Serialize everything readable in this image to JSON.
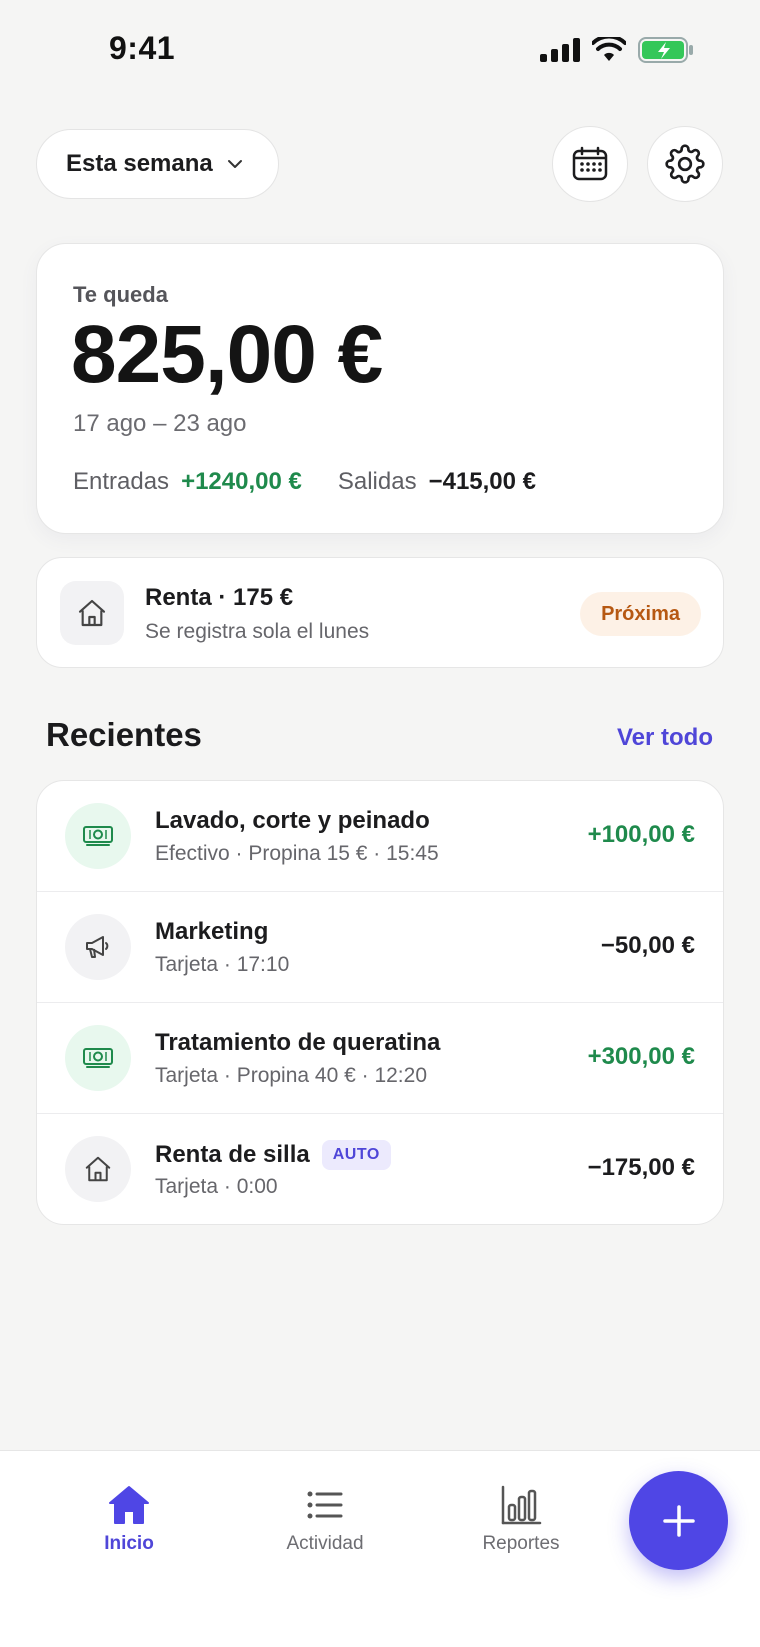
{
  "status_bar": {
    "time": "9:41"
  },
  "header": {
    "period_label": "Esta semana"
  },
  "balance": {
    "label": "Te queda",
    "amount": "825,00 €",
    "range": "17 ago – 23 ago",
    "income_label": "Entradas",
    "income_value": "+1240,00 €",
    "expense_label": "Salidas",
    "expense_value": "−415,00 €"
  },
  "recurring": {
    "title": "Renta · 175 €",
    "subtitle": "Se registra sola el lunes",
    "badge": "Próxima"
  },
  "recent": {
    "title": "Recientes",
    "see_all": "Ver todo",
    "items": [
      {
        "title": "Lavado, corte y peinado",
        "subtitle": "Efectivo · Propina 15 € · 15:45",
        "amount": "+100,00 €",
        "icon": "cash-icon"
      },
      {
        "title": "Marketing",
        "subtitle": "Tarjeta · 17:10",
        "amount": "−50,00 €",
        "icon": "megaphone-icon"
      },
      {
        "title": "Tratamiento de queratina",
        "subtitle": "Tarjeta · Propina 40 € · 12:20",
        "amount": "+300,00 €",
        "icon": "cash-icon"
      },
      {
        "title": "Renta de silla",
        "badge": "AUTO",
        "subtitle": "Tarjeta · 0:00",
        "amount": "−175,00 €",
        "icon": "house-icon"
      }
    ]
  },
  "tabs": [
    {
      "label": "Inicio",
      "icon": "home-icon",
      "active": true
    },
    {
      "label": "Actividad",
      "icon": "list-icon",
      "active": false
    },
    {
      "label": "Reportes",
      "icon": "bar-chart-icon",
      "active": false
    }
  ],
  "colors": {
    "accent": "#4f46e5",
    "income": "#1f8a4c",
    "badge_bg": "#fdf1e6",
    "badge_text": "#b65812"
  }
}
